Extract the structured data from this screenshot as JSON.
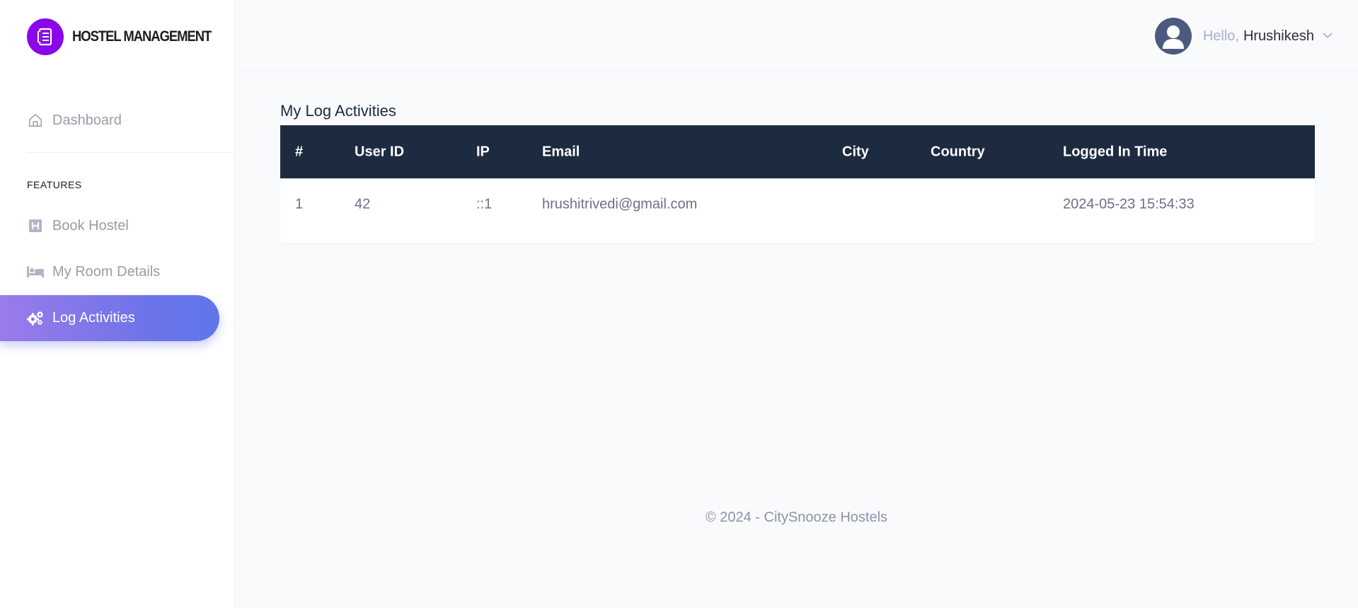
{
  "brand": {
    "name": "HOSTEL MANAGEMENT"
  },
  "sidebar": {
    "items": [
      {
        "label": "Dashboard",
        "icon": "home-icon"
      },
      {
        "label": "Book Hostel",
        "icon": "hotel-icon"
      },
      {
        "label": "My Room Details",
        "icon": "bed-icon"
      },
      {
        "label": "Log Activities",
        "icon": "cogs-icon",
        "active": true
      }
    ],
    "section_label": "FEATURES"
  },
  "header": {
    "greeting": "Hello,",
    "user_name": "Hrushikesh"
  },
  "main": {
    "title": "My Log Activities",
    "table": {
      "columns": [
        "#",
        "User ID",
        "IP",
        "Email",
        "City",
        "Country",
        "Logged In Time"
      ],
      "rows": [
        [
          "1",
          "42",
          "::1",
          "hrushitrivedi@gmail.com",
          "",
          "",
          "2024-05-23 15:54:33"
        ]
      ]
    }
  },
  "footer": {
    "text": "© 2024 - CitySnooze Hostels"
  },
  "colors": {
    "brand_purple": "#8a07ea",
    "table_header": "#1c2b40",
    "active_gradient_start": "#9b7bea",
    "active_gradient_end": "#5f77ea"
  }
}
